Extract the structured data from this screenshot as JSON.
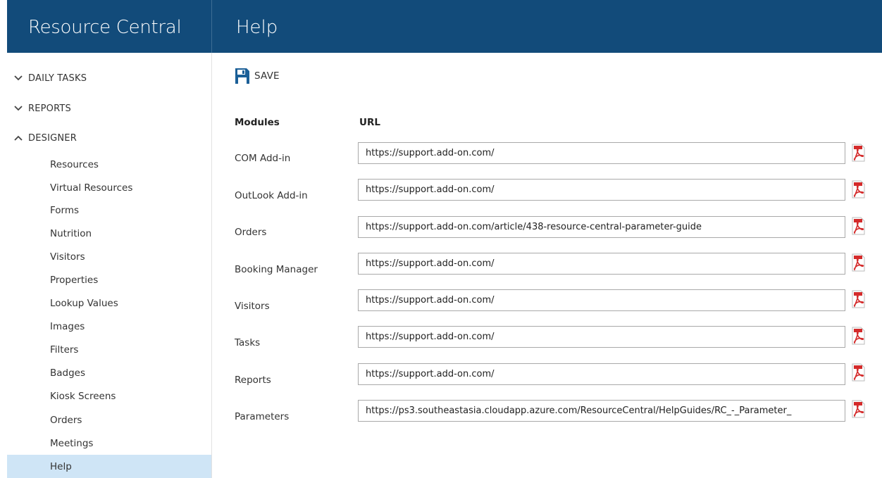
{
  "app": {
    "title": "Resource Central"
  },
  "page": {
    "title": "Help"
  },
  "sidebar": {
    "sections": [
      {
        "label": "DAILY TASKS",
        "expanded": false
      },
      {
        "label": "REPORTS",
        "expanded": false
      },
      {
        "label": "DESIGNER",
        "expanded": true
      }
    ],
    "designer_items": [
      "Resources",
      "Virtual Resources",
      "Forms",
      "Nutrition",
      "Visitors",
      "Properties",
      "Lookup Values",
      "Images",
      "Filters",
      "Badges",
      "Kiosk Screens",
      "Orders",
      "Meetings",
      "Help"
    ],
    "active_item": "Help"
  },
  "toolbar": {
    "save_label": "SAVE"
  },
  "table": {
    "headers": {
      "modules": "Modules",
      "url": "URL"
    },
    "rows": [
      {
        "module": "COM Add-in",
        "url": "https://support.add-on.com/"
      },
      {
        "module": "OutLook Add-in",
        "url": "https://support.add-on.com/"
      },
      {
        "module": "Orders",
        "url": "https://support.add-on.com/article/438-resource-central-parameter-guide"
      },
      {
        "module": "Booking Manager",
        "url": "https://support.add-on.com/"
      },
      {
        "module": "Visitors",
        "url": "https://support.add-on.com/"
      },
      {
        "module": "Tasks",
        "url": "https://support.add-on.com/"
      },
      {
        "module": "Reports",
        "url": "https://support.add-on.com/"
      },
      {
        "module": "Parameters",
        "url": "https://ps3.southeastasia.cloudapp.azure.com/ResourceCentral/HelpGuides/RC_-_Parameter_"
      }
    ]
  },
  "icons": {
    "row_action": "pdf-icon",
    "save": "floppy-disk-icon"
  },
  "colors": {
    "header_bg": "#124b7a",
    "active_bg": "#cfe5f6",
    "pdf_red": "#d42b2b"
  }
}
